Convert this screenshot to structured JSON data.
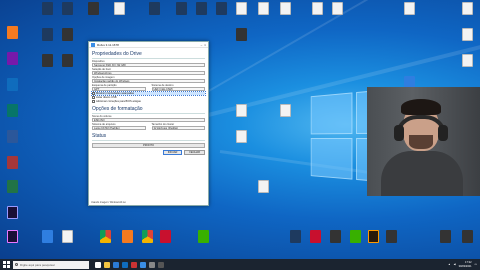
{
  "desktop": {
    "icons": [
      {
        "id": "i1",
        "label": "",
        "glyph": "g-orange"
      },
      {
        "id": "i2",
        "label": "",
        "glyph": "g-app"
      },
      {
        "id": "i3",
        "label": "",
        "glyph": "g-app"
      },
      {
        "id": "i4",
        "label": "",
        "glyph": "g-app"
      },
      {
        "id": "i5",
        "label": "",
        "glyph": "g-file"
      },
      {
        "id": "i6",
        "label": "",
        "glyph": "g-file"
      },
      {
        "id": "i7",
        "label": "",
        "glyph": "g-file"
      }
    ]
  },
  "rufus": {
    "title": "Rufus 3.11.1678",
    "section_drive": "Propriedades do Drive",
    "device_label": "Dispositivo",
    "device_value": "Samsung SSD (D:) [32 GB]",
    "boot_label": "Seleção de boot",
    "boot_value": "Windows10.iso",
    "image_option_label": "Opções de imagem",
    "image_option_value": "Instalação padrão do Windows",
    "partition_label": "Esquema de partição",
    "partition_value": "GPT",
    "target_label": "Sistema de destino",
    "target_value": "UEFI (não CSM)",
    "check_advanced": "Mostrar propriedades avançadas",
    "check_usb": "Listar discos USB",
    "check_fixes": "Adicionar correções para BIOS antigas",
    "section_format": "Opções de formatação",
    "volume_label": "Nome do volume",
    "volume_value": "ESD-ISO",
    "fs_label": "Sistema de arquivos",
    "fs_value": "Large FAT32 (Padrão)",
    "cluster_label": "Tamanho do cluster",
    "cluster_value": "32 kilobytes (Padrão)",
    "section_status": "Status",
    "progress_text": "PRONTO",
    "start_btn": "INICIAR",
    "close_btn": "FECHAR",
    "statusbar": "Usando imagem: Windows10.iso"
  },
  "taskbar": {
    "search_placeholder": "Digite aqui para pesquisar",
    "time": "17:32",
    "date": "30/03/2021"
  }
}
